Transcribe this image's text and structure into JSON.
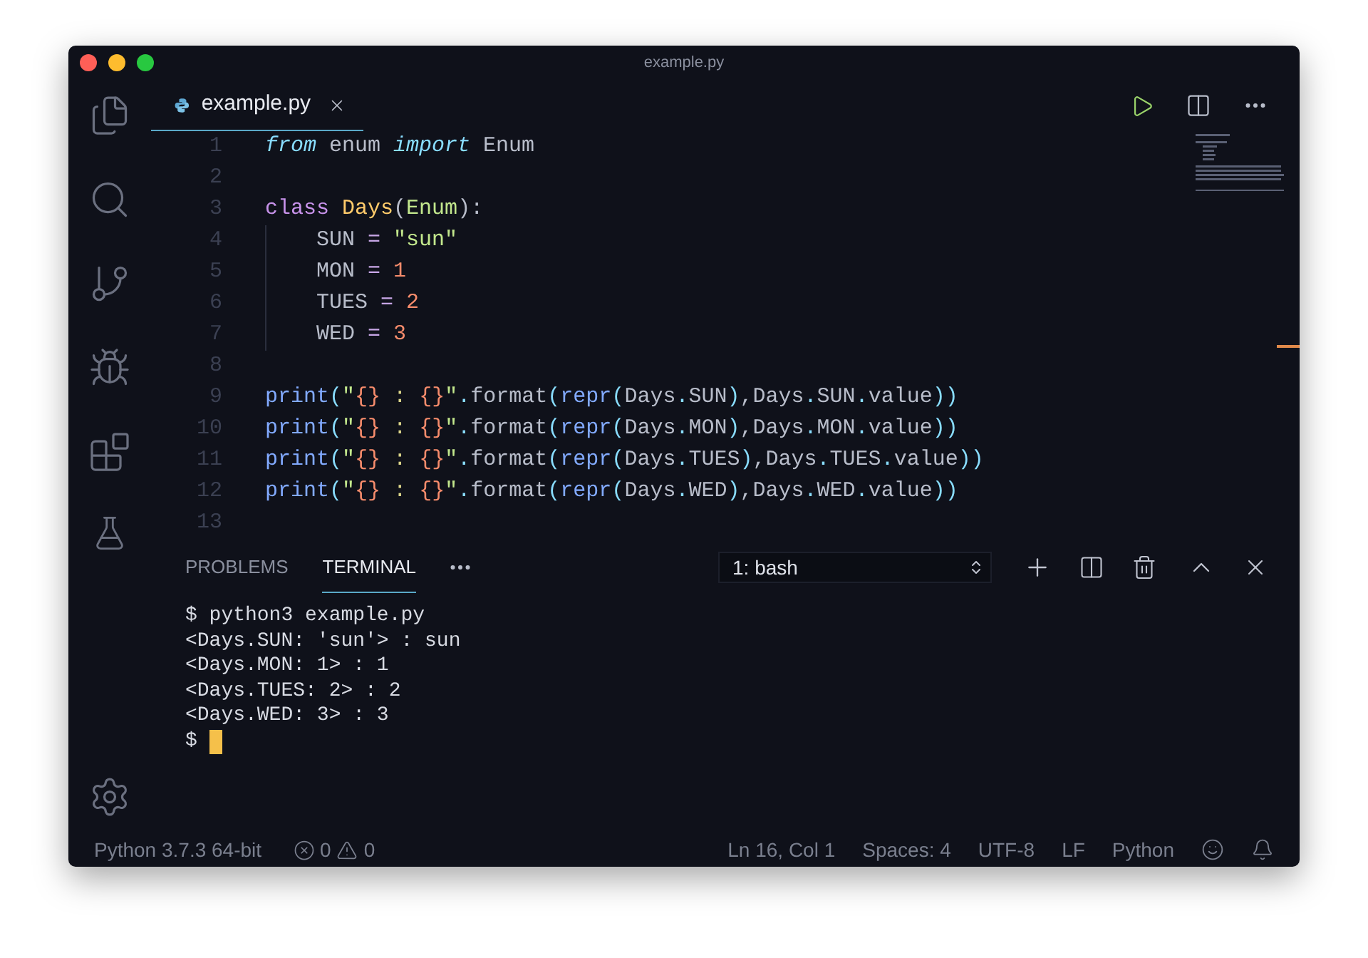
{
  "window": {
    "title": "example.py"
  },
  "tabs": [
    {
      "label": "example.py",
      "selected": true
    }
  ],
  "editor": {
    "lines": [
      {
        "number": "1",
        "tokens": [
          {
            "text": "from",
            "kind": "kw"
          },
          {
            "text": " enum ",
            "kind": "plain"
          },
          {
            "text": "import",
            "kind": "kw"
          },
          {
            "text": " Enum",
            "kind": "plain"
          }
        ]
      },
      {
        "number": "2"
      },
      {
        "number": "3",
        "tokens": [
          {
            "text": "class",
            "kind": "storage"
          },
          {
            "text": " Days",
            "kind": "classname"
          },
          {
            "text": "(",
            "kind": "punct"
          },
          {
            "text": "Enum",
            "kind": "type"
          },
          {
            "text": "):",
            "kind": "punct"
          }
        ],
        "children": [
          {
            "number": "4",
            "tokens": [
              {
                "text": "SUN",
                "kind": "plain"
              },
              {
                "text": " = ",
                "kind": "op"
              },
              {
                "text": "\"sun\"",
                "kind": "string"
              }
            ]
          },
          {
            "number": "5",
            "tokens": [
              {
                "text": "MON",
                "kind": "plain"
              },
              {
                "text": " = ",
                "kind": "op"
              },
              {
                "text": "1",
                "kind": "number"
              }
            ]
          },
          {
            "number": "6",
            "tokens": [
              {
                "text": "TUES",
                "kind": "plain"
              },
              {
                "text": " = ",
                "kind": "op"
              },
              {
                "text": "2",
                "kind": "number"
              }
            ]
          },
          {
            "number": "7",
            "tokens": [
              {
                "text": "WED",
                "kind": "plain"
              },
              {
                "text": " = ",
                "kind": "op"
              },
              {
                "text": "3",
                "kind": "number"
              }
            ]
          }
        ]
      },
      {
        "number": "8"
      },
      {
        "number": "9",
        "tokens": [
          {
            "text": "print",
            "kind": "func"
          },
          {
            "text": "(",
            "kind": "paren"
          },
          {
            "text": "\"",
            "kind": "string"
          },
          {
            "text": "{}",
            "kind": "brace"
          },
          {
            "text": " : ",
            "kind": "sep"
          },
          {
            "text": "{}",
            "kind": "brace"
          },
          {
            "text": "\"",
            "kind": "string"
          },
          {
            "text": ".",
            "kind": "dot"
          },
          {
            "text": "format",
            "kind": "plain"
          },
          {
            "text": "(",
            "kind": "paren"
          },
          {
            "text": "repr",
            "kind": "func"
          },
          {
            "text": "(",
            "kind": "paren"
          },
          {
            "text": "Days",
            "kind": "plain"
          },
          {
            "text": ".",
            "kind": "dot"
          },
          {
            "text": "SUN",
            "kind": "plain"
          },
          {
            "text": ")",
            "kind": "paren"
          },
          {
            "text": ",Days",
            "kind": "plain"
          },
          {
            "text": ".",
            "kind": "dot"
          },
          {
            "text": "SUN",
            "kind": "plain"
          },
          {
            "text": ".",
            "kind": "dot"
          },
          {
            "text": "value",
            "kind": "plain"
          },
          {
            "text": "))",
            "kind": "paren"
          }
        ]
      },
      {
        "number": "10",
        "tokens": [
          {
            "text": "print",
            "kind": "func"
          },
          {
            "text": "(",
            "kind": "paren"
          },
          {
            "text": "\"",
            "kind": "string"
          },
          {
            "text": "{}",
            "kind": "brace"
          },
          {
            "text": " : ",
            "kind": "sep"
          },
          {
            "text": "{}",
            "kind": "brace"
          },
          {
            "text": "\"",
            "kind": "string"
          },
          {
            "text": ".",
            "kind": "dot"
          },
          {
            "text": "format",
            "kind": "plain"
          },
          {
            "text": "(",
            "kind": "paren"
          },
          {
            "text": "repr",
            "kind": "func"
          },
          {
            "text": "(",
            "kind": "paren"
          },
          {
            "text": "Days",
            "kind": "plain"
          },
          {
            "text": ".",
            "kind": "dot"
          },
          {
            "text": "MON",
            "kind": "plain"
          },
          {
            "text": ")",
            "kind": "paren"
          },
          {
            "text": ",Days",
            "kind": "plain"
          },
          {
            "text": ".",
            "kind": "dot"
          },
          {
            "text": "MON",
            "kind": "plain"
          },
          {
            "text": ".",
            "kind": "dot"
          },
          {
            "text": "value",
            "kind": "plain"
          },
          {
            "text": "))",
            "kind": "paren"
          }
        ]
      },
      {
        "number": "11",
        "tokens": [
          {
            "text": "print",
            "kind": "func"
          },
          {
            "text": "(",
            "kind": "paren"
          },
          {
            "text": "\"",
            "kind": "string"
          },
          {
            "text": "{}",
            "kind": "brace"
          },
          {
            "text": " : ",
            "kind": "sep"
          },
          {
            "text": "{}",
            "kind": "brace"
          },
          {
            "text": "\"",
            "kind": "string"
          },
          {
            "text": ".",
            "kind": "dot"
          },
          {
            "text": "format",
            "kind": "plain"
          },
          {
            "text": "(",
            "kind": "paren"
          },
          {
            "text": "repr",
            "kind": "func"
          },
          {
            "text": "(",
            "kind": "paren"
          },
          {
            "text": "Days",
            "kind": "plain"
          },
          {
            "text": ".",
            "kind": "dot"
          },
          {
            "text": "TUES",
            "kind": "plain"
          },
          {
            "text": ")",
            "kind": "paren"
          },
          {
            "text": ",Days",
            "kind": "plain"
          },
          {
            "text": ".",
            "kind": "dot"
          },
          {
            "text": "TUES",
            "kind": "plain"
          },
          {
            "text": ".",
            "kind": "dot"
          },
          {
            "text": "value",
            "kind": "plain"
          },
          {
            "text": "))",
            "kind": "paren"
          }
        ]
      },
      {
        "number": "12",
        "tokens": [
          {
            "text": "print",
            "kind": "func"
          },
          {
            "text": "(",
            "kind": "paren"
          },
          {
            "text": "\"",
            "kind": "string"
          },
          {
            "text": "{}",
            "kind": "brace"
          },
          {
            "text": " : ",
            "kind": "sep"
          },
          {
            "text": "{}",
            "kind": "brace"
          },
          {
            "text": "\"",
            "kind": "string"
          },
          {
            "text": ".",
            "kind": "dot"
          },
          {
            "text": "format",
            "kind": "plain"
          },
          {
            "text": "(",
            "kind": "paren"
          },
          {
            "text": "repr",
            "kind": "func"
          },
          {
            "text": "(",
            "kind": "paren"
          },
          {
            "text": "Days",
            "kind": "plain"
          },
          {
            "text": ".",
            "kind": "dot"
          },
          {
            "text": "WED",
            "kind": "plain"
          },
          {
            "text": ")",
            "kind": "paren"
          },
          {
            "text": ",Days",
            "kind": "plain"
          },
          {
            "text": ".",
            "kind": "dot"
          },
          {
            "text": "WED",
            "kind": "plain"
          },
          {
            "text": ".",
            "kind": "dot"
          },
          {
            "text": "value",
            "kind": "plain"
          },
          {
            "text": "))",
            "kind": "paren"
          }
        ]
      },
      {
        "number": "13"
      }
    ]
  },
  "panel": {
    "tabs": [
      {
        "label": "PROBLEMS",
        "selected": false
      },
      {
        "label": "TERMINAL",
        "selected": true
      }
    ],
    "terminal_select": "1: bash",
    "terminal_lines": [
      "$ python3 example.py",
      "<Days.SUN: 'sun'> : sun",
      "<Days.MON: 1> : 1",
      "<Days.TUES: 2> : 2",
      "<Days.WED: 3> : 3"
    ],
    "prompt": "$"
  },
  "status_bar": {
    "interpreter": "Python 3.7.3 64-bit",
    "errors": "0",
    "warnings": "0",
    "right": [
      "Ln 16, Col 1",
      "Spaces: 4",
      "UTF-8",
      "LF",
      "Python"
    ]
  }
}
